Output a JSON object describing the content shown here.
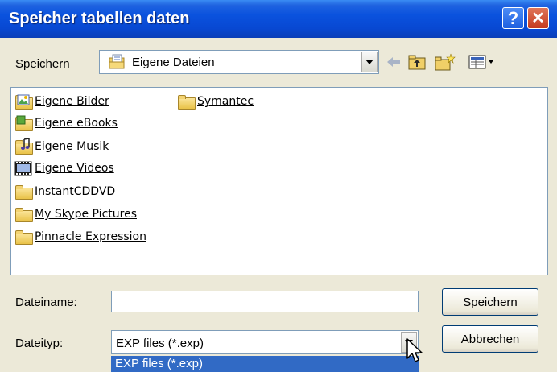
{
  "window": {
    "title": "Speicher tabellen daten",
    "help_label": "?",
    "close_label": "✕"
  },
  "toolbar": {
    "save_in_label": "Speichern",
    "save_in_value": "Eigene Dateien",
    "icons": [
      "folder-documents-icon",
      "back-arrow-icon",
      "up-one-level-icon",
      "new-folder-icon",
      "views-menu-icon"
    ]
  },
  "files": [
    {
      "name": "Eigene Bilder",
      "icon": "pictures-folder-icon"
    },
    {
      "name": "Eigene eBooks",
      "icon": "ebooks-folder-icon"
    },
    {
      "name": "Eigene Musik",
      "icon": "music-folder-icon"
    },
    {
      "name": "Eigene Videos",
      "icon": "videos-folder-icon"
    },
    {
      "name": "InstantCDDVD",
      "icon": "folder-icon"
    },
    {
      "name": "My Skype Pictures",
      "icon": "folder-icon"
    },
    {
      "name": "Pinnacle Expression",
      "icon": "folder-icon"
    },
    {
      "name": "Symantec",
      "icon": "folder-icon"
    }
  ],
  "form": {
    "filename_label": "Dateiname:",
    "filename_value": "",
    "filetype_label": "Dateityp:",
    "filetype_value": "EXP files (*.exp)",
    "filetype_option": "EXP files (*.exp)"
  },
  "buttons": {
    "save": "Speichern",
    "cancel": "Abbrechen"
  },
  "colors": {
    "titlebar": "#0a52de",
    "dialog_bg": "#ece9d8",
    "selection": "#316ac5"
  }
}
